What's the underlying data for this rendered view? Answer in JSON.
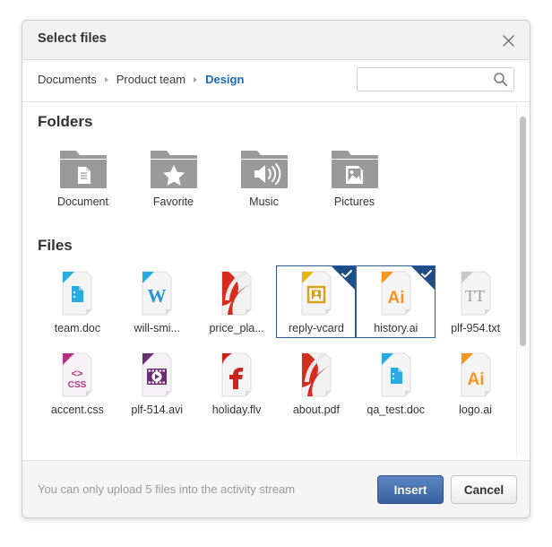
{
  "dialog": {
    "title": "Select files",
    "close_icon": "close-icon"
  },
  "breadcrumb": {
    "items": [
      {
        "label": "Documents",
        "active": false
      },
      {
        "label": "Product team",
        "active": false
      },
      {
        "label": "Design",
        "active": true
      }
    ]
  },
  "search": {
    "value": "",
    "placeholder": "",
    "icon": "search-icon"
  },
  "sections": {
    "folders_title": "Folders",
    "files_title": "Files"
  },
  "folders": [
    {
      "label": "Document",
      "icon": "folder-document-icon"
    },
    {
      "label": "Favorite",
      "icon": "folder-favorite-icon"
    },
    {
      "label": "Music",
      "icon": "folder-music-icon"
    },
    {
      "label": "Pictures",
      "icon": "folder-pictures-icon"
    }
  ],
  "files": [
    {
      "label": "team.doc",
      "icon": "file-doc-icon",
      "selected": false
    },
    {
      "label": "will-smi...",
      "icon": "file-word-icon",
      "selected": false
    },
    {
      "label": "price_pla...",
      "icon": "file-pdf-icon",
      "selected": false
    },
    {
      "label": "reply-vcard",
      "icon": "file-vcard-icon",
      "selected": true
    },
    {
      "label": "history.ai",
      "icon": "file-ai-icon",
      "selected": true
    },
    {
      "label": "plf-954.txt",
      "icon": "file-txt-icon",
      "selected": false
    },
    {
      "label": "accent.css",
      "icon": "file-css-icon",
      "selected": false
    },
    {
      "label": "plf-514.avi",
      "icon": "file-avi-icon",
      "selected": false
    },
    {
      "label": "holiday.flv",
      "icon": "file-flv-icon",
      "selected": false
    },
    {
      "label": "about.pdf",
      "icon": "file-pdf-icon",
      "selected": false
    },
    {
      "label": "qa_test.doc",
      "icon": "file-doc-icon",
      "selected": false
    },
    {
      "label": "logo.ai",
      "icon": "file-ai-icon",
      "selected": false
    }
  ],
  "footer": {
    "note": "You can only upload 5 files into the activity stream",
    "insert_label": "Insert",
    "cancel_label": "Cancel"
  },
  "colors": {
    "accent_blue": "#1d69b5",
    "selection_border": "#2a5d9e",
    "check_corner": "#1f4e87",
    "primary_button": "#39619f",
    "folder_gray": "#9a9a9a",
    "doc_blue": "#29abe2",
    "word_blue": "#2196d8",
    "pdf_red": "#d62c1f",
    "vcard_gold": "#d6a11b",
    "ai_orange": "#f7941e",
    "css_pink": "#b5317f",
    "avi_purple": "#6b2d73",
    "flv_red": "#c8251b",
    "txt_gray": "#9b9b9b",
    "note_gray": "#999999"
  },
  "scrollbar": {
    "visible": true
  }
}
